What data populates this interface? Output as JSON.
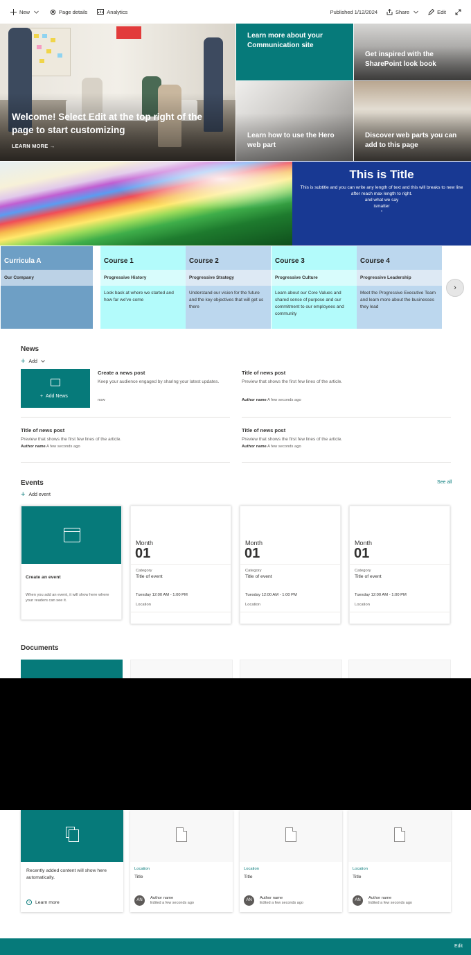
{
  "cmdbar": {
    "new_label": "New",
    "page_details_label": "Page details",
    "analytics_label": "Analytics",
    "published": "Published 1/12/2024",
    "share_label": "Share",
    "edit_label": "Edit"
  },
  "hero": {
    "main_title": "Welcome! Select Edit at the top right of the page to start customizing",
    "learn_more": "LEARN MORE →",
    "tiles": [
      "Learn more about your Communication site",
      "Get inspired with the SharePoint look book",
      "Learn how to use the Hero web part",
      "Discover web parts you can add to this page"
    ]
  },
  "banner": {
    "title": "This is Title",
    "subtitle": "This is subtitle and you can write any length of text and this will breaks to new line after reach max length to right.",
    "line2": "and what we say",
    "line3": "ismatter",
    "line4": "''"
  },
  "curricula": {
    "title": "Curricula A",
    "company": "Our Company",
    "courses": [
      {
        "title": "Course 1",
        "sub": "Progressive History",
        "desc": "Look back at where we started and how far we've come"
      },
      {
        "title": "Course 2",
        "sub": "Progressive Strategy",
        "desc": "Understand our vision for the future and the key objectives that will get us there"
      },
      {
        "title": "Course 3",
        "sub": "Progressive Culture",
        "desc": "Learn about our Core Values and shared sense of purpose and our commitment to our employees and community"
      },
      {
        "title": "Course 4",
        "sub": "Progressive Leadership",
        "desc": "Meet the Progressive Executive Team and learn more about the businesses they lead"
      }
    ],
    "next_glyph": "›"
  },
  "news": {
    "title": "News",
    "add_label": "Add",
    "add_news": "Add News",
    "create": {
      "title": "Create a news post",
      "desc": "Keep your audience engaged by sharing your latest updates.",
      "meta": "now"
    },
    "posts": [
      {
        "title": "Title of news post",
        "desc": "Preview that shows the first few lines of the article.",
        "author": "Author name",
        "time": "A few seconds ago"
      },
      {
        "title": "Title of news post",
        "desc": "Preview that shows the first few lines of the article.",
        "author": "Author name",
        "time": "A few seconds ago"
      },
      {
        "title": "Title of news post",
        "desc": "Preview that shows the first few lines of the article.",
        "author": "Author name",
        "time": "A few seconds ago"
      }
    ]
  },
  "events": {
    "title": "Events",
    "add_label": "Add event",
    "see_all": "See all",
    "create": {
      "title": "Create an event",
      "desc": "When you add an event, it will show here where your readers can see it."
    },
    "items": [
      {
        "month": "Month",
        "day": "01",
        "category": "Category",
        "title": "Title of event",
        "time": "Tuesday 12:00 AM - 1:00 PM",
        "location": "Location"
      },
      {
        "month": "Month",
        "day": "01",
        "category": "Category",
        "title": "Title of event",
        "time": "Tuesday 12:00 AM - 1:00 PM",
        "location": "Location"
      },
      {
        "month": "Month",
        "day": "01",
        "category": "Category",
        "title": "Title of event",
        "time": "Tuesday 12:00 AM - 1:00 PM",
        "location": "Location"
      }
    ]
  },
  "documents": {
    "title": "Documents",
    "recent_text": "Recently added content will show here automatically.",
    "learn_more": "Learn more",
    "items": [
      {
        "location": "Location",
        "title": "Title",
        "initials": "AN",
        "author": "Author name",
        "edited": "Edited a few seconds ago"
      },
      {
        "location": "Location",
        "title": "Title",
        "initials": "AN",
        "author": "Author name",
        "edited": "Edited a few seconds ago"
      },
      {
        "location": "Location",
        "title": "Title",
        "initials": "AN",
        "author": "Author name",
        "edited": "Edited a few seconds ago"
      }
    ]
  },
  "footer": {
    "edit_label": "Edit"
  },
  "colors": {
    "accent": "#067a7a",
    "banner": "#183993",
    "course_light": "#b3fbfb",
    "course_blue": "#bcd7ee"
  }
}
